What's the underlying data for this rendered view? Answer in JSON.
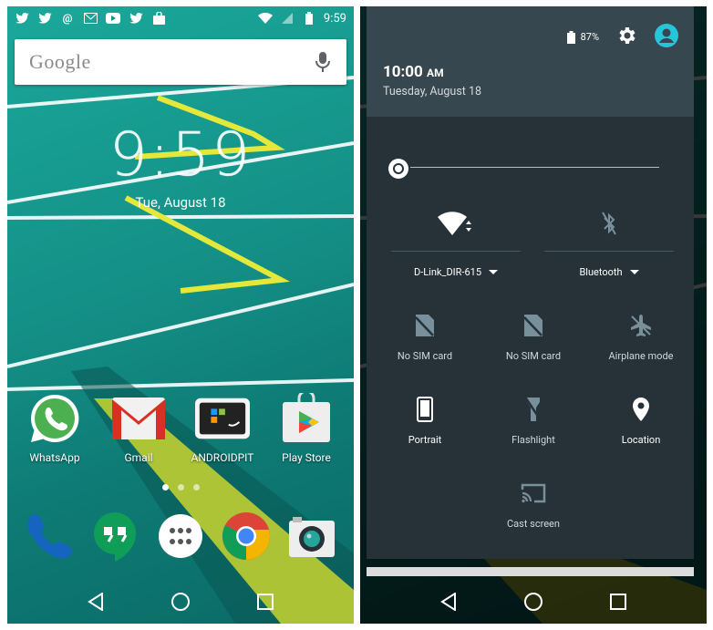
{
  "left_phone": {
    "status": {
      "time": "9:59"
    },
    "search": {
      "brand": "Google"
    },
    "clock": {
      "time": "9:59",
      "date": "Tue, August 18"
    },
    "apps": [
      {
        "label": "WhatsApp",
        "icon": "whatsapp-icon"
      },
      {
        "label": "Gmail",
        "icon": "gmail-icon"
      },
      {
        "label": "ANDROIDPIT",
        "icon": "androidpit-icon"
      },
      {
        "label": "Play Store",
        "icon": "play-store-icon"
      }
    ],
    "dock": [
      "phone-icon",
      "hangouts-icon",
      "app-drawer-icon",
      "chrome-icon",
      "camera-icon"
    ],
    "page_count": 3,
    "active_page": 1
  },
  "right_phone": {
    "header": {
      "battery": "87%",
      "time": "10:00",
      "ampm": "AM",
      "date": "Tuesday, August 18"
    },
    "wifi": {
      "label": "D-Link_DIR-615",
      "icon": "wifi-icon"
    },
    "bluetooth": {
      "label": "Bluetooth",
      "icon": "bluetooth-off-icon"
    },
    "tiles": [
      {
        "label": "No SIM card",
        "icon": "no-sim-icon"
      },
      {
        "label": "No SIM card",
        "icon": "no-sim-icon"
      },
      {
        "label": "Airplane mode",
        "icon": "airplane-icon"
      },
      {
        "label": "Portrait",
        "icon": "portrait-icon"
      },
      {
        "label": "Flashlight",
        "icon": "flashlight-icon"
      },
      {
        "label": "Location",
        "icon": "location-icon"
      },
      {
        "label": "Cast screen",
        "icon": "cast-icon"
      }
    ]
  },
  "colors": {
    "wallpaper": "#148f86",
    "qs_header": "#37474f",
    "qs_panel": "#263238",
    "accent": "#26c6da"
  }
}
